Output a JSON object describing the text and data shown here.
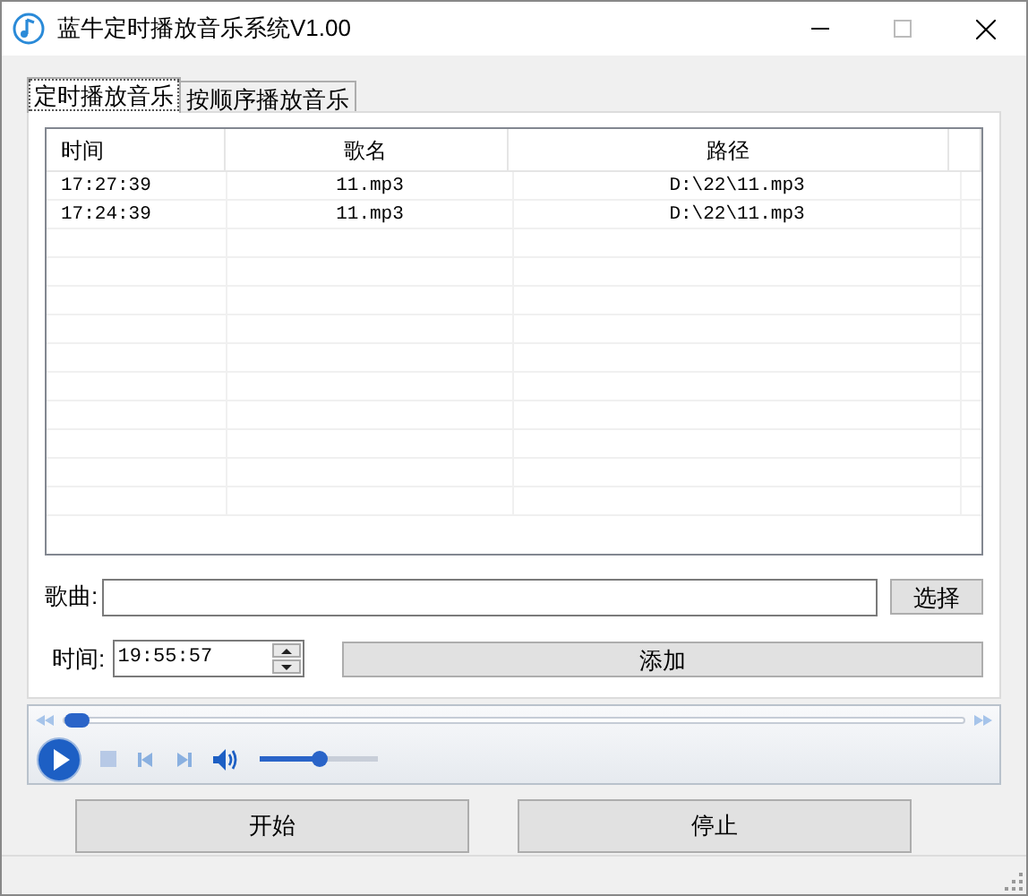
{
  "window": {
    "title": "蓝牛定时播放音乐系统V1.00"
  },
  "tabs": [
    {
      "label": "定时播放音乐",
      "selected": true
    },
    {
      "label": "按顺序播放音乐",
      "selected": false
    }
  ],
  "table": {
    "columns": [
      "时间",
      "歌名",
      "路径"
    ],
    "rows": [
      [
        "17:27:39",
        "11.mp3",
        "D:\\22\\11.mp3"
      ],
      [
        "17:24:39",
        "11.mp3",
        "D:\\22\\11.mp3"
      ]
    ]
  },
  "song_field": {
    "label": "歌曲:"
  },
  "choose_button": "选择",
  "time_field": {
    "label": "时间:",
    "value": "19:55:57"
  },
  "add_button": "添加",
  "player": {
    "progress": {
      "level": 0
    },
    "volume": {
      "level": 0.5
    }
  },
  "buttons": [
    "开始",
    "停止"
  ]
}
